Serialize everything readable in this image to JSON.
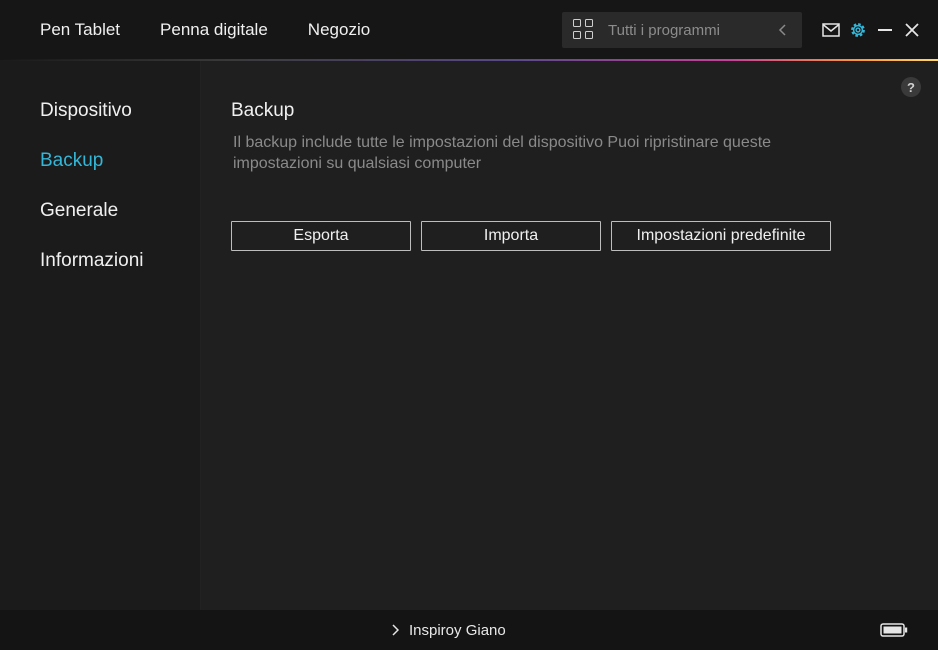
{
  "topnav": {
    "items": [
      "Pen Tablet",
      "Penna digitale",
      "Negozio"
    ]
  },
  "program_selector": {
    "label": "Tutti i programmi",
    "icon": "apps-grid-icon"
  },
  "window_controls": {
    "icons": [
      "mail-icon",
      "settings-gear-icon",
      "minimize-icon",
      "close-icon"
    ],
    "settings_color": "#34b6d8"
  },
  "sidebar": {
    "items": [
      {
        "label": "Dispositivo",
        "active": false
      },
      {
        "label": "Backup",
        "active": true
      },
      {
        "label": "Generale",
        "active": false
      },
      {
        "label": "Informazioni",
        "active": false
      }
    ],
    "active_color": "#34b6d8"
  },
  "main": {
    "help_label": "?",
    "title": "Backup",
    "description": "Il backup include tutte le impostazioni del dispositivo Puoi ripristinare queste impostazioni su qualsiasi computer",
    "buttons": {
      "export": "Esporta",
      "import": "Importa",
      "defaults": "Impostazioni predefinite"
    }
  },
  "footer": {
    "device_name": "Inspiroy Giano",
    "icons": [
      "chevron-right-icon",
      "battery-icon"
    ]
  }
}
